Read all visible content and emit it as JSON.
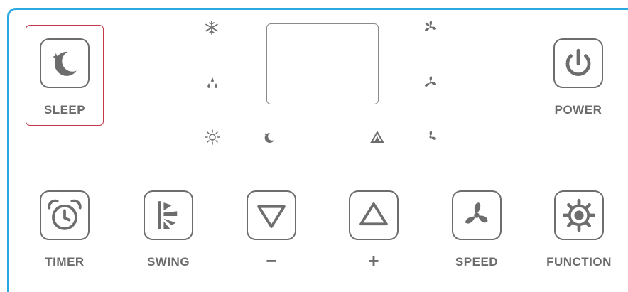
{
  "top_buttons": {
    "sleep": {
      "label": "SLEEP"
    },
    "power": {
      "label": "POWER"
    }
  },
  "bottom_buttons": [
    {
      "label": "TIMER"
    },
    {
      "label": "SWING"
    },
    {
      "label": "−"
    },
    {
      "label": "+"
    },
    {
      "label": "SPEED"
    },
    {
      "label": "FUNCTION"
    }
  ],
  "indicators": {
    "left": [
      "snowflake-icon",
      "droplets-icon",
      "sun-icon"
    ],
    "right": [
      "fan-high-icon",
      "fan-medium-icon",
      "fan-low-icon"
    ],
    "bottom": [
      "sleep-moon-icon",
      "auto-icon"
    ]
  },
  "colors": {
    "accent": "#29a9df",
    "selected": "#c23a4a",
    "icon": "#6d6d6d"
  }
}
